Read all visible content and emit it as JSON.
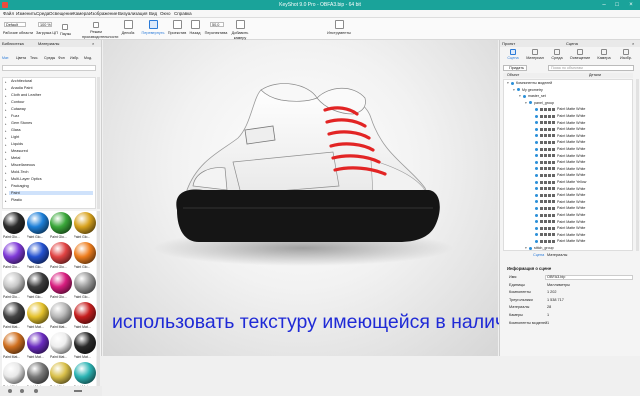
{
  "window": {
    "title": "KeyShot 9.0 Pro - OBFA3.bip - 64 bit"
  },
  "menu": [
    "Файл",
    "Изменить",
    "Среда",
    "Освещение",
    "Камера",
    "Изображение",
    "Визуализация",
    "Вид",
    "Окно",
    "Справка"
  ],
  "toolbar": {
    "workspace_select": "Default",
    "cpu_value": "100 %",
    "zoom_value": "50,0",
    "left_labels": [
      "Рабочие области",
      "Загрузка ЦП",
      "Паузы",
      "Режим производительности"
    ],
    "buttons": [
      "Денойз",
      "Перевернуть",
      "Проекстив",
      "Назад",
      "Перспектива",
      "Добавить камеру",
      "Инструменты"
    ],
    "active_button": "Перевернуть"
  },
  "library": {
    "title": "Библиотека",
    "panel_title": "Материалы",
    "tabs": [
      "Мат.",
      "Цвета",
      "Текс.",
      "Среды",
      "Фон",
      "Избр.",
      "Мод."
    ],
    "tree_items": [
      "Architectural",
      "Anadia Paint",
      "Cloth and Leather",
      "Contour",
      "Cutaway",
      "Fuzz",
      "Gem Stones",
      "Glass",
      "Light",
      "Liquids",
      "Measured",
      "Metal",
      "Miscellaneous",
      "Mold-Tech",
      "Multi-Layer Optics",
      "Packaging",
      "Paint",
      "Plastic"
    ],
    "selected_item": "Paint",
    "swatch_labels": [
      "Paint Glo...",
      "Paint Glo...",
      "Paint Glo...",
      "Paint Glo...",
      "Paint Glo...",
      "Paint Glo...",
      "Paint Glo...",
      "Paint Glo...",
      "Paint Glo...",
      "Paint Glo...",
      "Paint Glo...",
      "Paint Glo...",
      "Paint Mat...",
      "Paint Mat...",
      "Paint Mat...",
      "Paint Mat...",
      "Paint Mat...",
      "Paint Mat...",
      "Paint Mat...",
      "Paint Mat...",
      "Paint Mat...",
      "Paint Mat...",
      "Paint Mat...",
      "Paint Mat..."
    ],
    "swatch_colors": [
      "#2c2c2c",
      "#1d7fd8",
      "#3aa83a",
      "#d8a21d",
      "#7f3ad8",
      "#2452d0",
      "#e14343",
      "#ee7d1d",
      "#c8c8c8",
      "#3d3d3d",
      "#d81d7f",
      "#9a9a9a",
      "#444444",
      "#e4c12b",
      "#b8b8b8",
      "#c61e1e",
      "#d07020",
      "#6b2cc0",
      "#eeeeee",
      "#2a2a2a",
      "#e8e8e8",
      "#7a7a7a",
      "#d9c04a",
      "#2cb4b4",
      "#3b3b3b",
      "#2052c8",
      "#2f8e2f",
      "#b01818"
    ]
  },
  "overlay": {
    "subtitle": "использовать текстуру имеющейся в наличии кожи"
  },
  "project": {
    "title": "Проект",
    "section": "Сцена",
    "tabs": [
      "Сцена",
      "Материал",
      "Среда",
      "Освещение",
      "Камера",
      "Изобр."
    ],
    "active_tab": "Сцена",
    "toolbar": {
      "add_label": "Придать",
      "search_placeholder": "Поиск по объектам"
    },
    "columns": [
      "Объект",
      "Детали"
    ],
    "tree": [
      {
        "label": "Компоненты моделей",
        "depth": 0
      },
      {
        "label": "My geometry",
        "depth": 1
      },
      {
        "label": "master_set",
        "depth": 2
      },
      {
        "label": "panel_group",
        "depth": 3
      },
      {
        "label": "Paint Matte White",
        "depth": 4
      },
      {
        "label": "Paint Matte White",
        "depth": 4
      },
      {
        "label": "Paint Matte White",
        "depth": 4
      },
      {
        "label": "Paint Matte White",
        "depth": 4
      },
      {
        "label": "Paint Matte White",
        "depth": 4
      },
      {
        "label": "Paint Matte White",
        "depth": 4
      },
      {
        "label": "Paint Matte White",
        "depth": 4
      },
      {
        "label": "Paint Matte White",
        "depth": 4
      },
      {
        "label": "Paint Matte White",
        "depth": 4
      },
      {
        "label": "Paint Matte White",
        "depth": 4
      },
      {
        "label": "Paint Matte White",
        "depth": 4
      },
      {
        "label": "Paint Matte Yellow",
        "depth": 4
      },
      {
        "label": "Paint Matte White",
        "depth": 4
      },
      {
        "label": "Paint Matte White",
        "depth": 4
      },
      {
        "label": "Paint Matte White",
        "depth": 4
      },
      {
        "label": "Paint Matte White",
        "depth": 4
      },
      {
        "label": "Paint Matte White",
        "depth": 4
      },
      {
        "label": "Paint Matte White",
        "depth": 4
      },
      {
        "label": "Paint Matte White",
        "depth": 4
      },
      {
        "label": "Paint Matte White",
        "depth": 4
      },
      {
        "label": "Paint Matte White",
        "depth": 4
      },
      {
        "label": "stitch_group",
        "depth": 3
      }
    ],
    "bottom_tabs": [
      "Сцена",
      "Материалы"
    ],
    "info_title": "Информация о сцене",
    "info": [
      {
        "key": "Имя",
        "value": "OBFA3.bip"
      },
      {
        "key": "Единицы",
        "value": "Миллиметры"
      },
      {
        "key": "Компоненты",
        "value": "1 202"
      },
      {
        "key": "Треугольники",
        "value": "1 538 717"
      },
      {
        "key": "Материалы",
        "value": "28"
      },
      {
        "key": "Камеры",
        "value": "1"
      },
      {
        "key": "Компоненты моделей",
        "value": "1"
      }
    ]
  }
}
